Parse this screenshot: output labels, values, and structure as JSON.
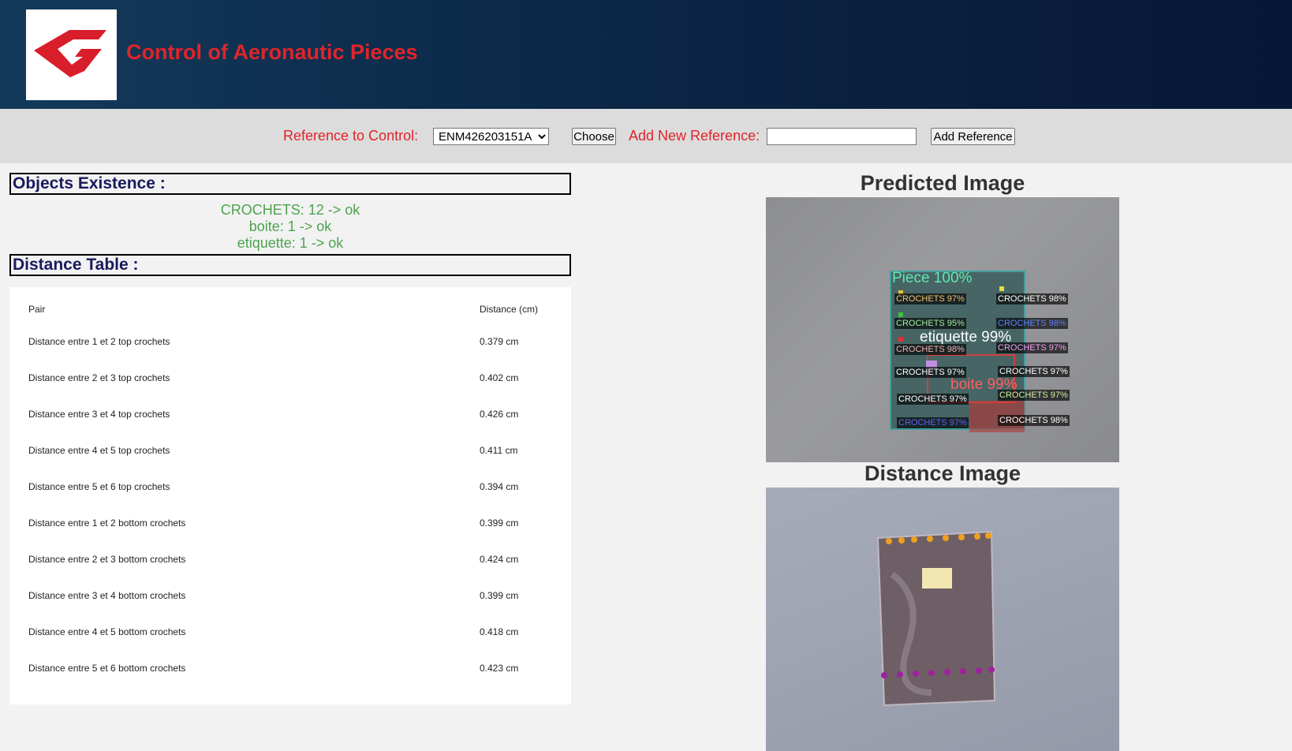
{
  "header": {
    "title": "Control of Aeronautic Pieces",
    "logo_icon": "company-logo-g"
  },
  "toolbar": {
    "reference_label": "Reference to Control:",
    "reference_selected": "ENM426203151A",
    "choose_button": "Choose",
    "add_new_label": "Add New Reference:",
    "add_new_value": "",
    "add_button": "Add Reference"
  },
  "objects_existence": {
    "title": "Objects Existence :",
    "items": [
      "CROCHETS: 12 -> ok",
      "boite: 1 -> ok",
      "etiquette: 1 -> ok"
    ]
  },
  "distance_table": {
    "title": "Distance Table :",
    "columns": [
      "Pair",
      "Distance (cm)"
    ],
    "rows": [
      [
        "Distance entre 1 et 2 top crochets",
        "0.379 cm"
      ],
      [
        "Distance entre 2 et 3 top crochets",
        "0.402 cm"
      ],
      [
        "Distance entre 3 et 4 top crochets",
        "0.426 cm"
      ],
      [
        "Distance entre 4 et 5 top crochets",
        "0.411 cm"
      ],
      [
        "Distance entre 5 et 6 top crochets",
        "0.394 cm"
      ],
      [
        "Distance entre 1 et 2 bottom crochets",
        "0.399 cm"
      ],
      [
        "Distance entre 2 et 3 bottom crochets",
        "0.424 cm"
      ],
      [
        "Distance entre 3 et 4 bottom crochets",
        "0.399 cm"
      ],
      [
        "Distance entre 4 et 5 bottom crochets",
        "0.418 cm"
      ],
      [
        "Distance entre 5 et 6 bottom crochets",
        "0.423 cm"
      ]
    ]
  },
  "predicted_image": {
    "title": "Predicted Image",
    "labels": {
      "piece": "Piece 100%",
      "etiquette": "etiquette 99%",
      "boite": "boite 99%",
      "c1": "CROCHETS 97%",
      "c2": "CROCHETS 98%",
      "c3": "CROCHETS 95%",
      "c4": "CROCHETS 98%",
      "c5": "CROCHETS 98%",
      "c6": "CROCHETS 97%",
      "c7": "CROCHETS 97%",
      "c8": "CROCHETS 97%",
      "c9": "CROCHETS 97%",
      "c10": "CROCHETS 97%",
      "c11": "CROCHETS 97%",
      "c12": "CROCHETS 98%"
    }
  },
  "distance_image": {
    "title": "Distance Image"
  }
}
